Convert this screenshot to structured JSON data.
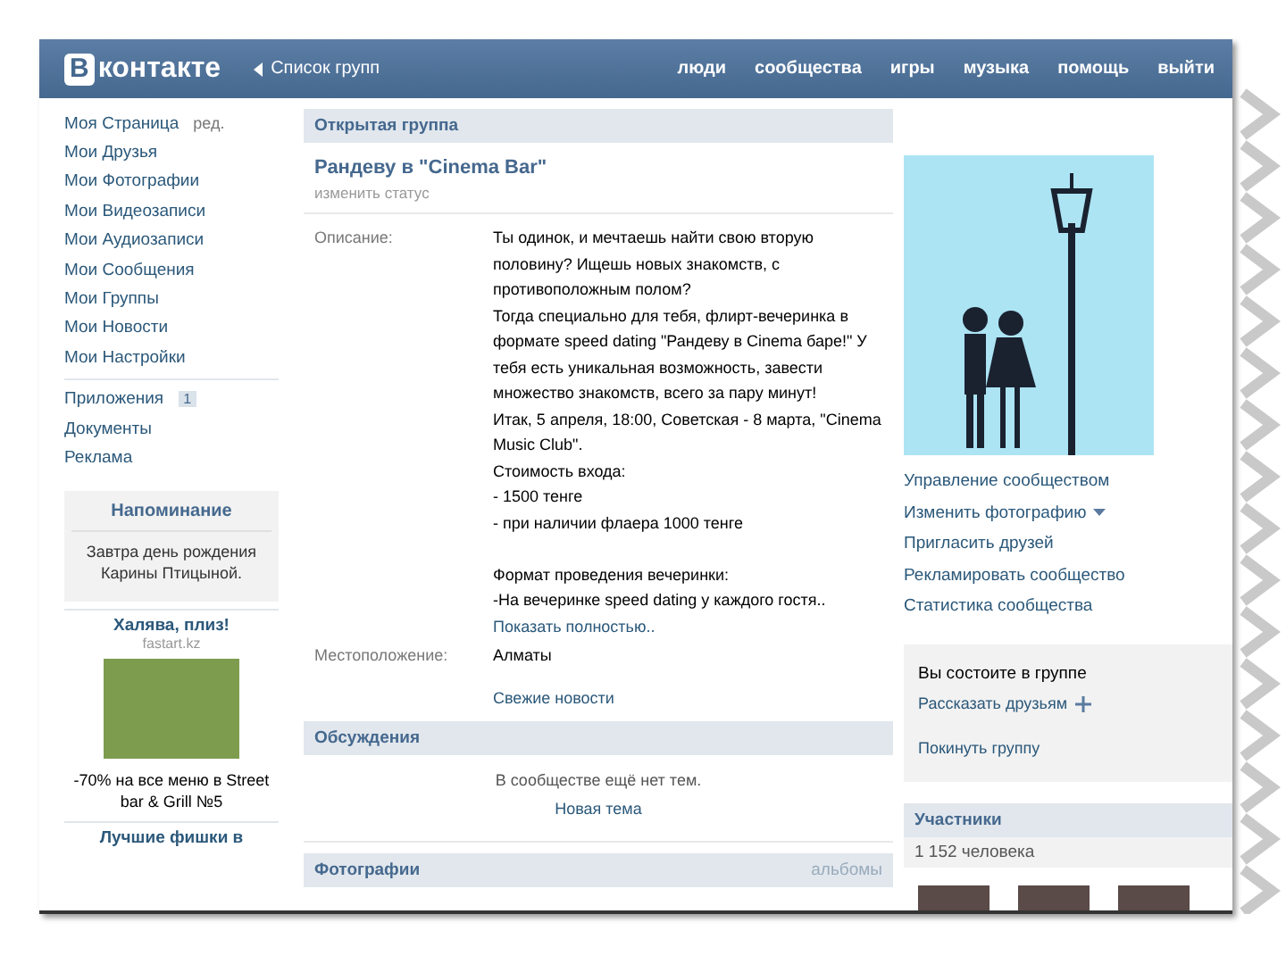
{
  "header": {
    "logo_mark": "В",
    "logo_text": "контакте",
    "back_link": "Список групп",
    "nav": [
      "люди",
      "сообщества",
      "игры",
      "музыка",
      "помощь",
      "выйти"
    ]
  },
  "sidebar": {
    "menu": [
      {
        "label": "Моя Страница",
        "edit": "ред."
      },
      {
        "label": "Мои Друзья"
      },
      {
        "label": "Мои Фотографии"
      },
      {
        "label": "Мои Видеозаписи"
      },
      {
        "label": "Мои Аудиозаписи"
      },
      {
        "label": "Мои Сообщения"
      },
      {
        "label": "Мои Группы"
      },
      {
        "label": "Мои Новости"
      },
      {
        "label": "Мои Настройки"
      }
    ],
    "extra": [
      {
        "label": "Приложения",
        "badge": "1"
      },
      {
        "label": "Документы"
      },
      {
        "label": "Реклама"
      }
    ],
    "reminder": {
      "title": "Напоминание",
      "text": "Завтра день рождения Карины Птицыной."
    },
    "ad": {
      "title": "Халява, плиз!",
      "domain": "fastart.kz",
      "caption": "-70% на все меню в Street bar & Grill №5"
    },
    "ad_next_title": "Лучшие фишки в"
  },
  "main": {
    "section_label": "Открытая группа",
    "group_name": "Рандеву в \"Cinema Bar\"",
    "status_link": "изменить статус",
    "description_label": "Описание:",
    "description": [
      [
        "Ты одинок, и мечтаешь найти свою вторую половину? Ищешь новых знакомств, с противоположным полом?",
        "Тогда специально для тебя, флирт-вечеринка в формате speed dating \"Рандеву в Cinema баре!\" У тебя есть уникальная возможность, завести множество знакомств, всего за пару минут!",
        "Итак, 5 апреля, 18:00, Советская - 8 марта, \"Cinema Music Club\".",
        "Стоимость входа:",
        "- 1500 тенге",
        "- при наличии флаера 1000 тенге"
      ],
      [
        "Формат проведения вечеринки:",
        "-На вечеринке speed dating у каждого гостя.."
      ]
    ],
    "show_more": "Показать полностью..",
    "location_label": "Местоположение:",
    "location": "Алматы",
    "fresh_news": "Свежие новости",
    "discussions": {
      "title": "Обсуждения",
      "empty": "В сообществе ещё нет тем.",
      "new_topic": "Новая тема"
    },
    "photos": {
      "title": "Фотографии",
      "albums": "альбомы"
    }
  },
  "right": {
    "actions": [
      {
        "label": "Управление сообществом",
        "caret": false
      },
      {
        "label": "Изменить фотографию",
        "caret": true
      },
      {
        "label": "Пригласить друзей",
        "caret": false
      },
      {
        "label": "Рекламировать сообщество",
        "caret": false
      },
      {
        "label": "Статистика сообщества",
        "caret": false
      }
    ],
    "membership": {
      "text": "Вы состоите в группе",
      "tell_friends": "Рассказать друзьям",
      "leave": "Покинуть группу"
    },
    "members": {
      "title": "Участники",
      "count": "1 152 человека"
    }
  }
}
